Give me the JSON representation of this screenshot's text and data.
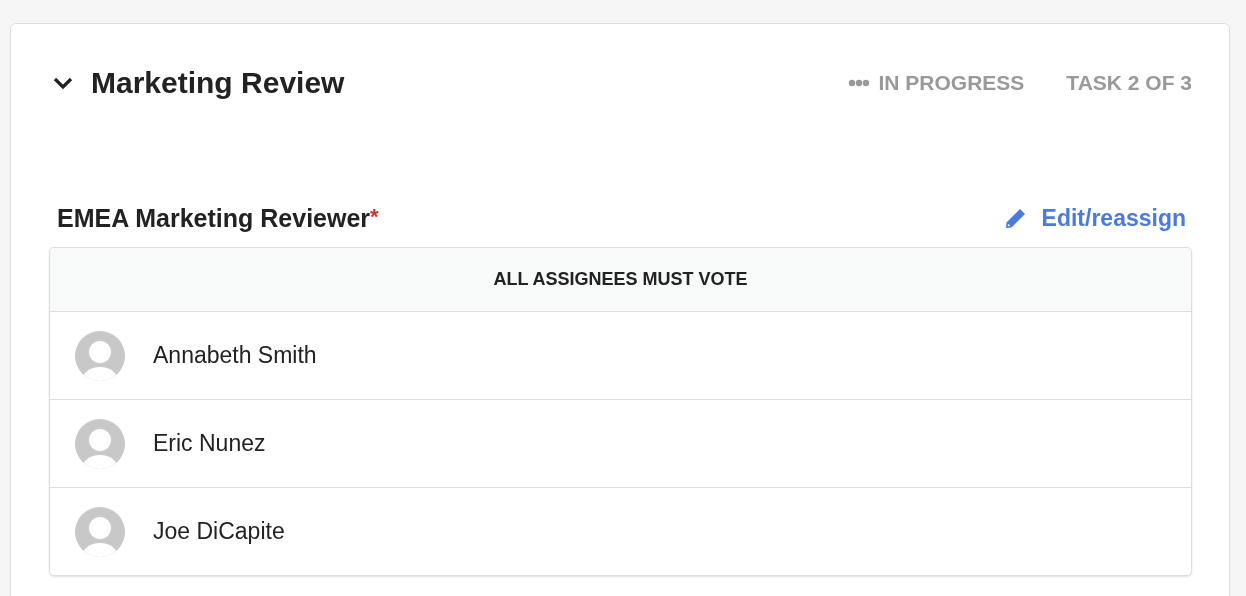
{
  "card": {
    "title": "Marketing Review",
    "expanded": true,
    "status": "IN PROGRESS",
    "progress": "TASK 2 OF 3"
  },
  "section": {
    "label": "EMEA Marketing Reviewer",
    "required_mark": "*",
    "action": "Edit/reassign"
  },
  "table": {
    "header": "ALL ASSIGNEES MUST VOTE",
    "rows": [
      {
        "name": "Annabeth Smith"
      },
      {
        "name": "Eric Nunez"
      },
      {
        "name": "Joe DiCapite"
      }
    ]
  }
}
